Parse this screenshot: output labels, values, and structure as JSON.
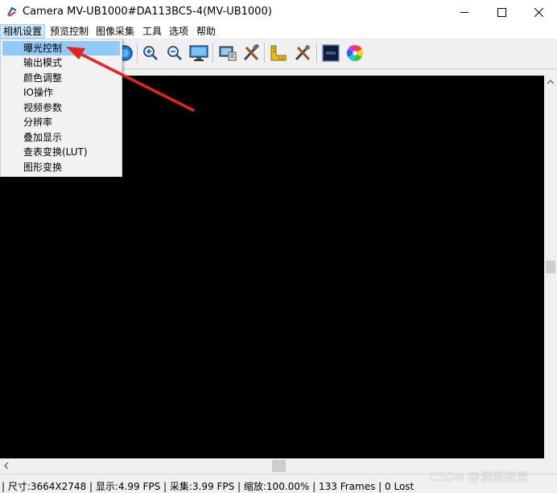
{
  "window": {
    "title": "Camera MV-UB1000#DA113BC5-4(MV-UB1000)",
    "icons": {
      "app": "camera-app-icon",
      "minimize": "minimize-icon",
      "maximize": "maximize-icon",
      "close": "close-icon"
    }
  },
  "menubar": {
    "items": [
      "相机设置",
      "预览控制",
      "图像采集",
      "工具",
      "选项",
      "帮助"
    ],
    "active_index": 0
  },
  "dropdown": {
    "items": [
      "曝光控制",
      "输出模式",
      "颜色调整",
      "IO操作",
      "视频参数",
      "分辨率",
      "叠加显示",
      "查表变换(LUT)",
      "图形变换"
    ],
    "highlighted_index": 0
  },
  "toolbar": {
    "icons": [
      "capture-blue-icon",
      "zoom-in-icon",
      "zoom-out-icon",
      "monitor-icon",
      "screen-settings-icon",
      "tools-icon",
      "ruler-icon",
      "settings-tools-icon",
      "auto-exposure-icon",
      "color-wheel-icon"
    ]
  },
  "status": {
    "text": "| 尺寸:3664X2748 | 显示:4.99 FPS | 采集:3.99 FPS | 缩放:100.00% | 133 Frames | 0 Lost"
  },
  "watermark": "CSDN @洞观视觉",
  "colors": {
    "accent_arrow": "#e8231c",
    "menu_highlight": "#91c9f7",
    "viewport": "#000000"
  }
}
